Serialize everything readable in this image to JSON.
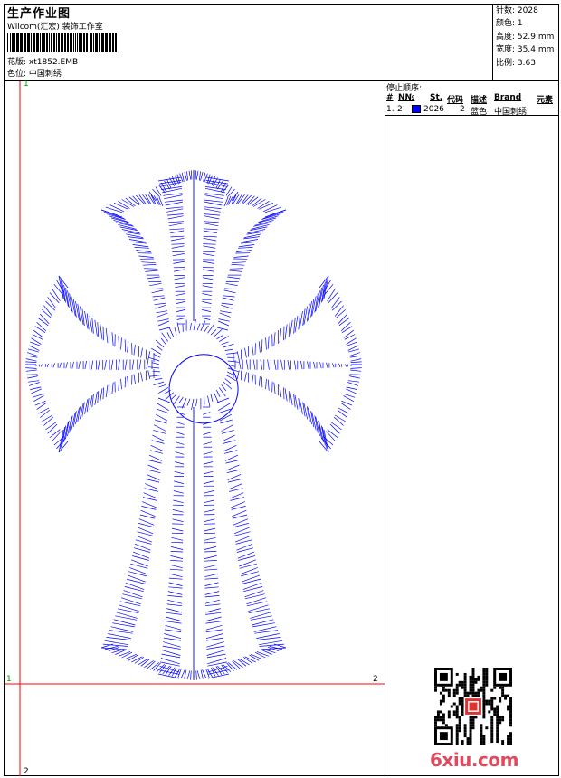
{
  "header": {
    "title": "生产作业图",
    "company": "Wilcom(汇宏) 装饰工作室",
    "design_label": "花版:",
    "design_value": "xt1852.EMB",
    "color_label": "色位:",
    "color_value": "中国刺绣"
  },
  "stats": {
    "stitches_label": "针数:",
    "stitches": "2028",
    "colors_label": "颜色:",
    "colors": "1",
    "height_label": "高度:",
    "height": "52.9 mm",
    "width_label": "宽度:",
    "width": "35.4 mm",
    "ratio_label": "比例:",
    "ratio": "3.63"
  },
  "sequence": {
    "title": "停止顺序:",
    "columns": [
      "#",
      "N№",
      "St.",
      "代码",
      "描述",
      "Brand",
      "元素"
    ],
    "rows": [
      {
        "index": "1.",
        "needle": "2",
        "color": "#0000ff",
        "stitches": "2026",
        "code": "2",
        "desc": "蓝色",
        "brand": "中国刺绣",
        "element": ""
      }
    ]
  },
  "axes": {
    "x_start": "1",
    "x_end": "2",
    "y_start": "1",
    "y_end": "2"
  },
  "colors": {
    "thread": "#0000ff",
    "guide": "#ff0000",
    "watermark": "#e04a5e"
  },
  "watermark": "6xiu.com"
}
